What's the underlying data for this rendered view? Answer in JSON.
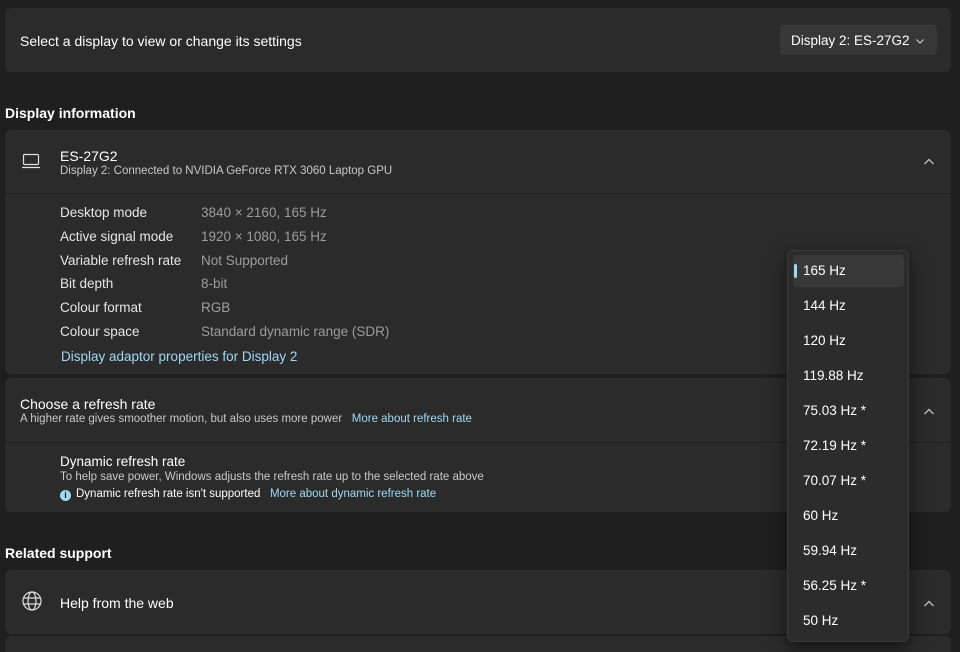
{
  "select_display": {
    "label": "Select a display to view or change its settings",
    "selected": "Display 2: ES-27G2"
  },
  "display_info": {
    "section_title": "Display information",
    "name": "ES-27G2",
    "subtitle": "Display 2: Connected to NVIDIA GeForce RTX 3060 Laptop GPU",
    "specs": [
      {
        "key": "Desktop mode",
        "value": "3840 × 2160, 165 Hz"
      },
      {
        "key": "Active signal mode",
        "value": "1920 × 1080, 165 Hz"
      },
      {
        "key": "Variable refresh rate",
        "value": "Not Supported"
      },
      {
        "key": "Bit depth",
        "value": "8-bit"
      },
      {
        "key": "Colour format",
        "value": "RGB"
      },
      {
        "key": "Colour space",
        "value": "Standard dynamic range (SDR)"
      }
    ],
    "adaptor_link": "Display adaptor properties for Display 2"
  },
  "refresh": {
    "title": "Choose a refresh rate",
    "description": "A higher rate gives smoother motion, but also uses more power",
    "more_link": "More about refresh rate",
    "dynamic_title": "Dynamic refresh rate",
    "dynamic_desc": "To help save power, Windows adjusts the refresh rate up to the selected rate above",
    "dynamic_note": "Dynamic refresh rate isn't supported",
    "dynamic_link": "More about dynamic refresh rate"
  },
  "related": {
    "section_title": "Related support",
    "help_label": "Help from the web"
  },
  "rate_menu": {
    "selected_index": 0,
    "options": [
      "165 Hz",
      "144 Hz",
      "120 Hz",
      "119.88 Hz",
      "75.03 Hz *",
      "72.19 Hz *",
      "70.07 Hz *",
      "60 Hz",
      "59.94 Hz",
      "56.25 Hz *",
      "50 Hz"
    ]
  },
  "colors": {
    "background": "#1f1f1f",
    "card": "#2b2b2b",
    "accent": "#9fd8f4"
  },
  "icons": [
    "chevron-down-icon",
    "monitor-icon",
    "chevron-up-icon",
    "info-icon",
    "globe-icon"
  ]
}
